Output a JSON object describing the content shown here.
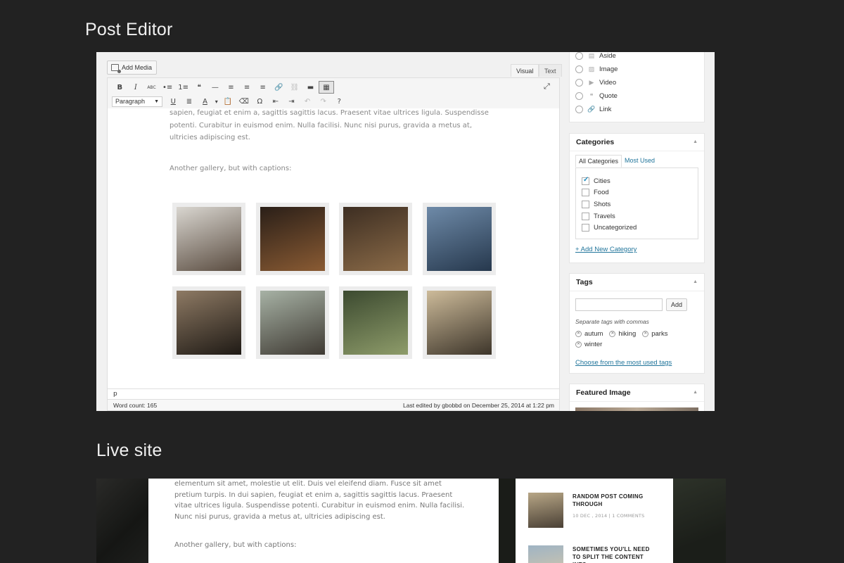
{
  "headings": {
    "editor": "Post Editor",
    "live": "Live site"
  },
  "editor": {
    "add_media": "Add Media",
    "tabs": {
      "visual": "Visual",
      "text": "Text"
    },
    "toolbar_row1": [
      "B",
      "I",
      "ABC",
      "•≡",
      "1≡",
      "❝",
      "—",
      "≡",
      "≡",
      "≡",
      "🔗",
      "⛓",
      "▬",
      "▦"
    ],
    "format_select": "Paragraph",
    "toolbar_row2": [
      "U",
      "≣",
      "A",
      "▾",
      "📋",
      "⌫",
      "Ω",
      "⇤",
      "⇥",
      "↶",
      "↷",
      "?"
    ],
    "paragraph": "sapien, feugiat et enim a, sagittis sagittis lacus. Praesent vitae ultrices ligula. Suspendisse potenti. Curabitur in euismod enim. Nulla facilisi. Nunc nisi purus, gravida a metus at, ultricies adipiscing est.",
    "paragraph2": "Another gallery, but with captions:",
    "path": "p",
    "word_count": "Word count: 165",
    "last_edited": "Last edited by gbobbd on December 25, 2014 at 1:22 pm"
  },
  "sidebar": {
    "formats": [
      {
        "label": "Aside",
        "icon": "▤"
      },
      {
        "label": "Image",
        "icon": "▨"
      },
      {
        "label": "Video",
        "icon": "▶"
      },
      {
        "label": "Quote",
        "icon": "❝"
      },
      {
        "label": "Link",
        "icon": "🔗"
      }
    ],
    "categories": {
      "title": "Categories",
      "tab_all": "All Categories",
      "tab_used": "Most Used",
      "items": [
        {
          "label": "Cities",
          "checked": true
        },
        {
          "label": "Food",
          "checked": false
        },
        {
          "label": "Shots",
          "checked": false
        },
        {
          "label": "Travels",
          "checked": false
        },
        {
          "label": "Uncategorized",
          "checked": false
        }
      ],
      "add_new": "+ Add New Category"
    },
    "tags": {
      "title": "Tags",
      "add_button": "Add",
      "input_value": "",
      "hint": "Separate tags with commas",
      "chips": [
        "autum",
        "hiking",
        "parks",
        "winter"
      ],
      "choose": "Choose from the most used tags"
    },
    "featured": {
      "title": "Featured Image"
    },
    "collapse_icon": "▲"
  },
  "gallery_colors": [
    [
      "#d9d6d0",
      "#5a4c40"
    ],
    [
      "#2a1f18",
      "#8a5b33"
    ],
    [
      "#3d2e22",
      "#8b6b48"
    ],
    [
      "#6e8aa8",
      "#26384d"
    ],
    [
      "#8e7a64",
      "#1f1a15"
    ],
    [
      "#a7b2a5",
      "#3f3a33"
    ],
    [
      "#3c4a30",
      "#8e9c6a"
    ],
    [
      "#cdbb9a",
      "#3d352a"
    ]
  ],
  "live": {
    "paragraph": "elementum sit amet, molestie ut elit. Duis vel eleifend diam. Fusce sit amet pretium turpis. In dui sapien, feugiat et enim a, sagittis sagittis lacus. Praesent vitae ultrices ligula. Suspendisse potenti. Curabitur in euismod enim. Nulla facilisi. Nunc nisi purus, gravida a metus at, ultricies adipiscing est.",
    "paragraph2": "Another gallery, but with captions:",
    "posts": [
      {
        "title": "Random post coming through",
        "meta": "10 DEC , 2014  |  1 COMMENTS",
        "colors": [
          "#b7a686",
          "#4a4035"
        ]
      },
      {
        "title": "Sometimes you'll need to split the content into",
        "meta": "",
        "colors": [
          "#9fb4c4",
          "#d8c8a8"
        ]
      }
    ]
  }
}
